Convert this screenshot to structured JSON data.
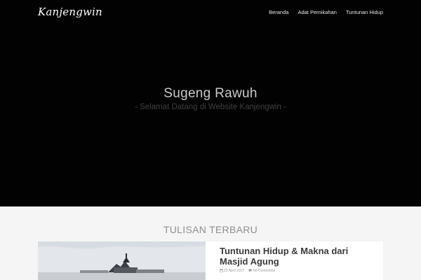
{
  "site": {
    "logo": "Kanjengwin"
  },
  "nav": {
    "items": [
      "Beranda",
      "Adat Pernikahan",
      "Tuntunan Hidup"
    ]
  },
  "hero": {
    "title": "Sugeng Rawuh",
    "subtitle": "- Selamat Datang di Website Kanjengwin -"
  },
  "recent": {
    "heading": "TULISAN TERBARU",
    "post": {
      "title": "Tuntunan Hidup & Makna dari Masjid Agung",
      "date": "23 April 2017",
      "comments": "No Comments",
      "date_icon": "calendar-icon",
      "comments_icon": "comment-icon"
    }
  }
}
